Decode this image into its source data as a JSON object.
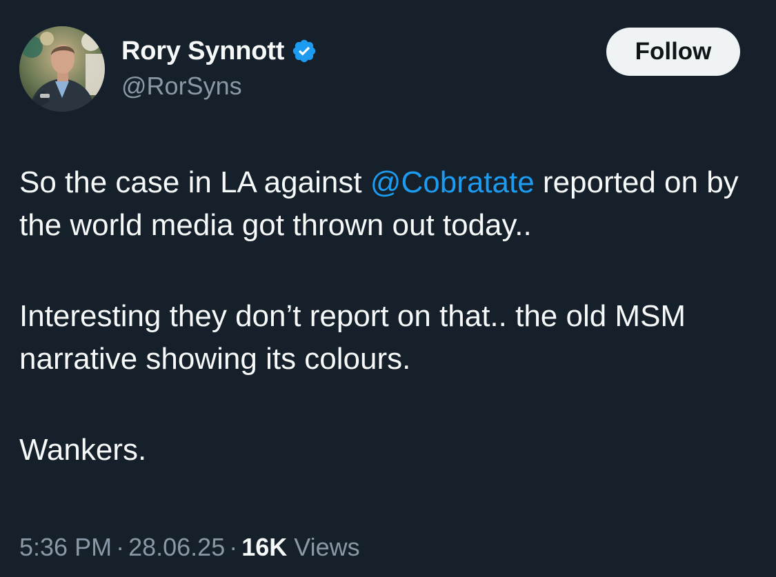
{
  "author": {
    "display_name": "Rory Synnott",
    "handle": "@RorSyns",
    "verified": true,
    "verified_color": "#1d9bf0"
  },
  "follow_button": {
    "label": "Follow"
  },
  "tweet": {
    "paragraph1_before": "So the case in LA against ",
    "paragraph1_mention": "@Cobratate",
    "paragraph1_after": " reported on by the world media got thrown out today..",
    "paragraph2": "Interesting they don’t report on that.. the old MSM narrative showing its colours.",
    "paragraph3": "Wankers."
  },
  "meta": {
    "time": "5:36 PM",
    "separator": "·",
    "date": "28.06.25",
    "views_count": "16K",
    "views_label": "Views"
  },
  "colors": {
    "background": "#15202b",
    "text_primary": "#f7f9f9",
    "text_secondary": "#8b98a5",
    "accent": "#1d9bf0"
  },
  "icons": {
    "verified": "verified-badge-icon",
    "avatar": "profile-photo"
  }
}
